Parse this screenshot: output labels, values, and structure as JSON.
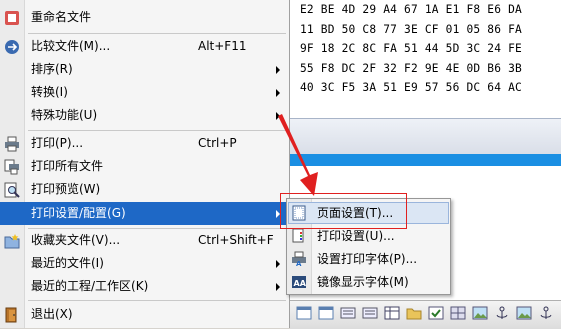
{
  "hex_lines": [
    "E2 BE 4D 29 A4 67 1A E1 F8 E6 DA",
    "11 BD 50 C8 77 3E CF 01 05 86 FA",
    "9F 18 2C 8C FA 51 44 5D 3C 24 FE",
    "55 F8 DC 2F 32 F2 9E 4E 0D B6 3B",
    "40 3C F5 3A 51 E9 57 56 DC 64 AC"
  ],
  "main_menu": {
    "rename": "重命名文件",
    "compare": {
      "label": "比较文件(M)...",
      "shortcut": "Alt+F11"
    },
    "sort": "排序(R)",
    "convert": "转换(I)",
    "special": "特殊功能(U)",
    "print": {
      "label": "打印(P)...",
      "shortcut": "Ctrl+P"
    },
    "print_all": "打印所有文件",
    "print_preview": "打印预览(W)",
    "print_setup": "打印设置/配置(G)",
    "favorites": {
      "label": "收藏夹文件(V)...",
      "shortcut": "Ctrl+Shift+F"
    },
    "recent_files": "最近的文件(I)",
    "recent_projects": "最近的工程/工作区(K)",
    "exit": "退出(X)"
  },
  "sub_menu": {
    "page_setup": "页面设置(T)...",
    "print_setup": "打印设置(U)...",
    "print_font": "设置打印字体(P)...",
    "mirror_font": "镜像显示字体(M)"
  },
  "colors": {
    "selected_bg": "#1e68c6",
    "annotation": "#e02020",
    "blue_strip": "#1a8fe3"
  }
}
